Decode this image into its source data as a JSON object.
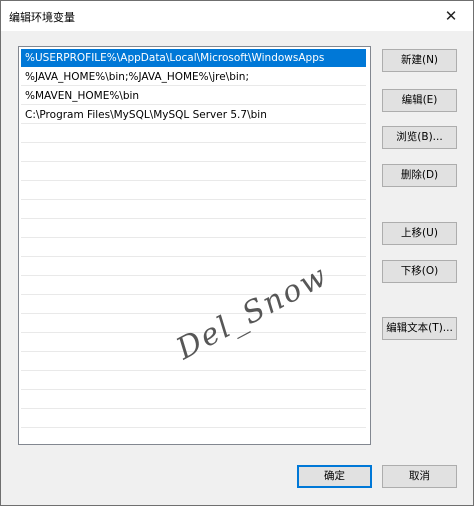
{
  "window": {
    "title": "编辑环境变量",
    "close_glyph": "✕"
  },
  "list": {
    "items": [
      "%USERPROFILE%\\AppData\\Local\\Microsoft\\WindowsApps",
      "%JAVA_HOME%\\bin;%JAVA_HOME%\\jre\\bin;",
      "%MAVEN_HOME%\\bin",
      "C:\\Program Files\\MySQL\\MySQL Server 5.7\\bin"
    ],
    "selected_index": 0
  },
  "buttons": {
    "new": "新建(N)",
    "edit": "编辑(E)",
    "browse": "浏览(B)...",
    "delete": "删除(D)",
    "move_up": "上移(U)",
    "move_down": "下移(O)",
    "edit_text": "编辑文本(T)...",
    "ok": "确定",
    "cancel": "取消"
  },
  "watermark": "Del_Snow",
  "colors": {
    "selection": "#0078d7",
    "button_face": "#e1e1e1",
    "dialog_bg": "#f0f0f0"
  }
}
